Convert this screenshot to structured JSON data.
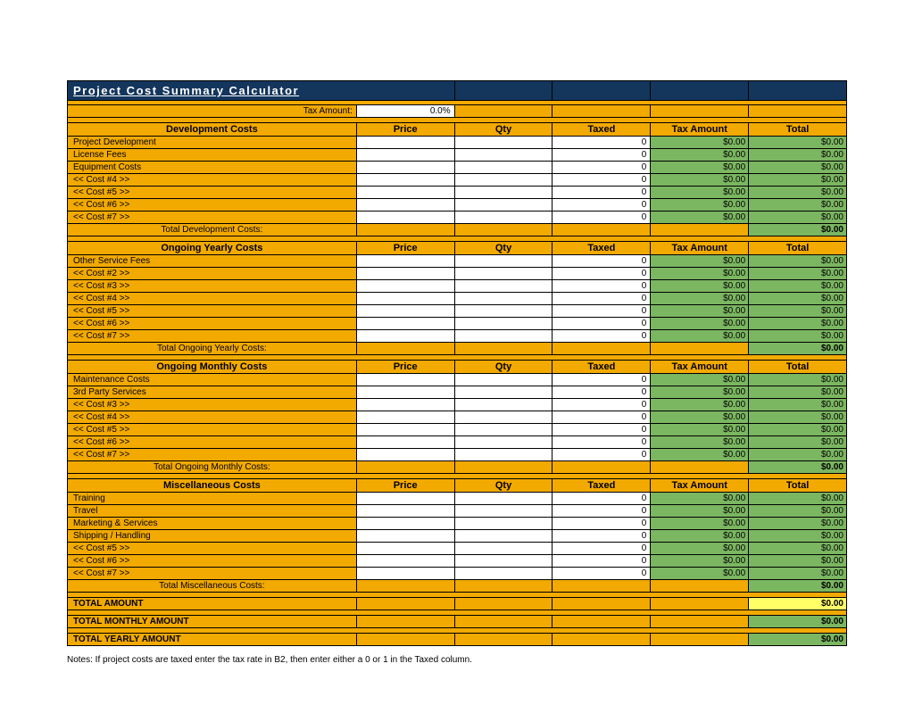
{
  "title": "Project Cost Summary Calculator",
  "tax": {
    "label": "Tax Amount:",
    "value": "0.0%"
  },
  "columns": [
    "Price",
    "Qty",
    "Taxed",
    "Tax Amount",
    "Total"
  ],
  "sections": [
    {
      "header": "Development Costs",
      "rows": [
        {
          "label": "Project Development",
          "price": "",
          "qty": "",
          "taxed": "0",
          "tax_amt": "$0.00",
          "total": "$0.00"
        },
        {
          "label": "License Fees",
          "price": "",
          "qty": "",
          "taxed": "0",
          "tax_amt": "$0.00",
          "total": "$0.00"
        },
        {
          "label": "Equipment Costs",
          "price": "",
          "qty": "",
          "taxed": "0",
          "tax_amt": "$0.00",
          "total": "$0.00"
        },
        {
          "label": "<< Cost #4 >>",
          "price": "",
          "qty": "",
          "taxed": "0",
          "tax_amt": "$0.00",
          "total": "$0.00"
        },
        {
          "label": "<< Cost #5 >>",
          "price": "",
          "qty": "",
          "taxed": "0",
          "tax_amt": "$0.00",
          "total": "$0.00"
        },
        {
          "label": "<< Cost #6 >>",
          "price": "",
          "qty": "",
          "taxed": "0",
          "tax_amt": "$0.00",
          "total": "$0.00"
        },
        {
          "label": "<< Cost #7 >>",
          "price": "",
          "qty": "",
          "taxed": "0",
          "tax_amt": "$0.00",
          "total": "$0.00"
        }
      ],
      "subtotal_label": "Total Development Costs:",
      "subtotal_value": "$0.00"
    },
    {
      "header": "Ongoing Yearly Costs",
      "rows": [
        {
          "label": "Other Service Fees",
          "price": "",
          "qty": "",
          "taxed": "0",
          "tax_amt": "$0.00",
          "total": "$0.00"
        },
        {
          "label": "<< Cost #2 >>",
          "price": "",
          "qty": "",
          "taxed": "0",
          "tax_amt": "$0.00",
          "total": "$0.00"
        },
        {
          "label": "<< Cost #3 >>",
          "price": "",
          "qty": "",
          "taxed": "0",
          "tax_amt": "$0.00",
          "total": "$0.00"
        },
        {
          "label": "<< Cost #4 >>",
          "price": "",
          "qty": "",
          "taxed": "0",
          "tax_amt": "$0.00",
          "total": "$0.00"
        },
        {
          "label": "<< Cost #5 >>",
          "price": "",
          "qty": "",
          "taxed": "0",
          "tax_amt": "$0.00",
          "total": "$0.00"
        },
        {
          "label": "<< Cost #6 >>",
          "price": "",
          "qty": "",
          "taxed": "0",
          "tax_amt": "$0.00",
          "total": "$0.00"
        },
        {
          "label": "<< Cost #7 >>",
          "price": "",
          "qty": "",
          "taxed": "0",
          "tax_amt": "$0.00",
          "total": "$0.00"
        }
      ],
      "subtotal_label": "Total Ongoing Yearly Costs:",
      "subtotal_value": "$0.00"
    },
    {
      "header": "Ongoing Monthly Costs",
      "rows": [
        {
          "label": "Maintenance Costs",
          "price": "",
          "qty": "",
          "taxed": "0",
          "tax_amt": "$0.00",
          "total": "$0.00"
        },
        {
          "label": "3rd Party Services",
          "price": "",
          "qty": "",
          "taxed": "0",
          "tax_amt": "$0.00",
          "total": "$0.00"
        },
        {
          "label": "<< Cost #3 >>",
          "price": "",
          "qty": "",
          "taxed": "0",
          "tax_amt": "$0.00",
          "total": "$0.00"
        },
        {
          "label": "<< Cost #4 >>",
          "price": "",
          "qty": "",
          "taxed": "0",
          "tax_amt": "$0.00",
          "total": "$0.00"
        },
        {
          "label": "<< Cost #5 >>",
          "price": "",
          "qty": "",
          "taxed": "0",
          "tax_amt": "$0.00",
          "total": "$0.00"
        },
        {
          "label": "<< Cost #6 >>",
          "price": "",
          "qty": "",
          "taxed": "0",
          "tax_amt": "$0.00",
          "total": "$0.00"
        },
        {
          "label": "<< Cost #7 >>",
          "price": "",
          "qty": "",
          "taxed": "0",
          "tax_amt": "$0.00",
          "total": "$0.00"
        }
      ],
      "subtotal_label": "Total Ongoing Monthly Costs:",
      "subtotal_value": "$0.00"
    },
    {
      "header": "Miscellaneous Costs",
      "rows": [
        {
          "label": "Training",
          "price": "",
          "qty": "",
          "taxed": "0",
          "tax_amt": "$0.00",
          "total": "$0.00"
        },
        {
          "label": "Travel",
          "price": "",
          "qty": "",
          "taxed": "0",
          "tax_amt": "$0.00",
          "total": "$0.00"
        },
        {
          "label": "Marketing & Services",
          "price": "",
          "qty": "",
          "taxed": "0",
          "tax_amt": "$0.00",
          "total": "$0.00"
        },
        {
          "label": "Shipping / Handling",
          "price": "",
          "qty": "",
          "taxed": "0",
          "tax_amt": "$0.00",
          "total": "$0.00"
        },
        {
          "label": "<< Cost #5 >>",
          "price": "",
          "qty": "",
          "taxed": "0",
          "tax_amt": "$0.00",
          "total": "$0.00"
        },
        {
          "label": "<< Cost #6 >>",
          "price": "",
          "qty": "",
          "taxed": "0",
          "tax_amt": "$0.00",
          "total": "$0.00"
        },
        {
          "label": "<< Cost #7 >>",
          "price": "",
          "qty": "",
          "taxed": "0",
          "tax_amt": "$0.00",
          "total": "$0.00"
        }
      ],
      "subtotal_label": "Total Miscellaneous Costs:",
      "subtotal_value": "$0.00"
    }
  ],
  "grand_totals": [
    {
      "label": "TOTAL AMOUNT",
      "value": "$0.00",
      "highlight": true
    },
    {
      "label": "TOTAL MONTHLY AMOUNT",
      "value": "$0.00",
      "highlight": false
    },
    {
      "label": "TOTAL YEARLY AMOUNT",
      "value": "$0.00",
      "highlight": false
    }
  ],
  "notes": "Notes: If project costs are taxed enter the tax rate in B2, then enter either a 0 or 1 in the Taxed column."
}
